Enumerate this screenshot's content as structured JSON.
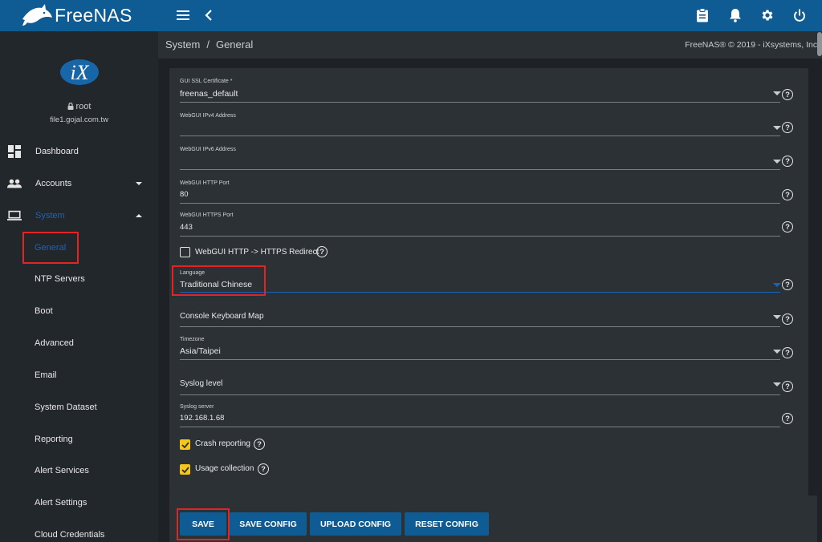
{
  "app": {
    "logo_text": "FreeNAS",
    "brand_color": "#0f5c95",
    "accent_color": "#f5c518"
  },
  "topbar": {
    "icons": [
      "menu-icon",
      "chevron-left-icon",
      "clipboard-icon",
      "bell-icon",
      "gear-icon",
      "power-icon"
    ]
  },
  "sidebar": {
    "user": "root",
    "host": "file1.gojal.com.tw",
    "items": [
      {
        "label": "Dashboard",
        "icon": "dashboard-icon"
      },
      {
        "label": "Accounts",
        "icon": "people-icon"
      },
      {
        "label": "System",
        "icon": "laptop-icon"
      }
    ],
    "system_sub": [
      "General",
      "NTP Servers",
      "Boot",
      "Advanced",
      "Email",
      "System Dataset",
      "Reporting",
      "Alert Services",
      "Alert Settings",
      "Cloud Credentials"
    ]
  },
  "breadcrumb": {
    "parent": "System",
    "separator": "/",
    "current": "General"
  },
  "copyright": "FreeNAS® © 2019 - iXsystems, Inc.",
  "form": {
    "ssl_cert": {
      "label": "GUI SSL Certificate *",
      "value": "freenas_default"
    },
    "ipv4": {
      "label": "WebGUI IPv4 Address",
      "value": ""
    },
    "ipv6": {
      "label": "WebGUI IPv6 Address",
      "value": ""
    },
    "http_port": {
      "label": "WebGUI HTTP Port",
      "value": "80"
    },
    "https_port": {
      "label": "WebGUI HTTPS Port",
      "value": "443"
    },
    "redirect": {
      "label": "WebGUI HTTP -> HTTPS Redirect",
      "checked": false
    },
    "language": {
      "label": "Language",
      "value": "Traditional Chinese"
    },
    "kbd_map": {
      "label": "Console Keyboard Map",
      "value": ""
    },
    "timezone": {
      "label": "Timezone",
      "value": "Asia/Taipei"
    },
    "syslog_level": {
      "label": "Syslog level",
      "value": ""
    },
    "syslog_server": {
      "label": "Syslog server",
      "value": "192.168.1.68"
    },
    "crash_reporting": {
      "label": "Crash reporting",
      "checked": true
    },
    "usage_collection": {
      "label": "Usage collection",
      "checked": true
    },
    "help_glyph": "?"
  },
  "buttons": {
    "save": "SAVE",
    "save_config": "SAVE CONFIG",
    "upload_config": "UPLOAD CONFIG",
    "reset_config": "RESET CONFIG"
  }
}
